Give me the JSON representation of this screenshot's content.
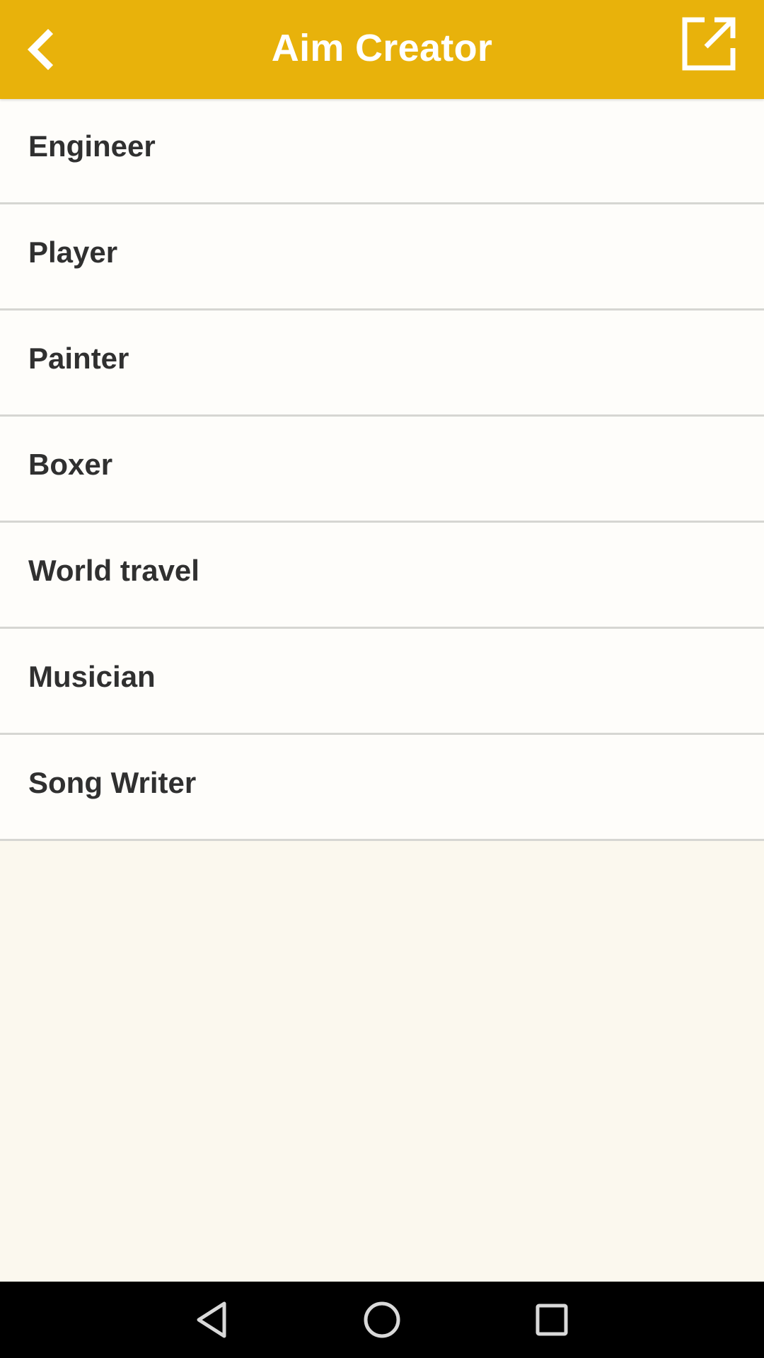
{
  "app_bar": {
    "title": "Aim Creator",
    "back_icon": "chevron-left-icon",
    "share_icon": "open-in-new-icon",
    "background_color": "#e8b20b"
  },
  "list": {
    "items": [
      {
        "label": "Engineer"
      },
      {
        "label": "Player"
      },
      {
        "label": "Painter"
      },
      {
        "label": "Boxer"
      },
      {
        "label": "World travel"
      },
      {
        "label": "Musician"
      },
      {
        "label": "Song Writer"
      }
    ]
  },
  "nav_bar": {
    "back_icon": "triangle-back-icon",
    "home_icon": "circle-home-icon",
    "recents_icon": "square-recents-icon"
  }
}
